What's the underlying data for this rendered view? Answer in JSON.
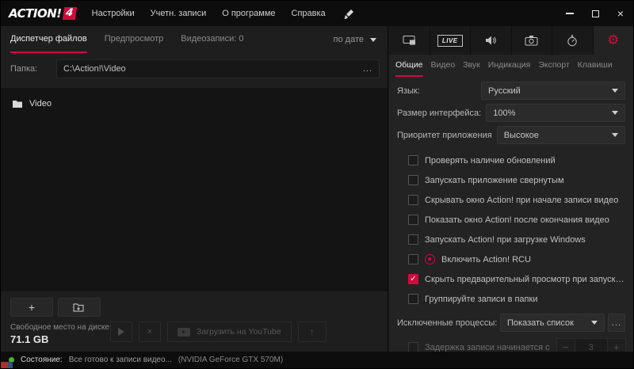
{
  "colors": {
    "accent": "#d10b3c",
    "status_green": "#4db32b"
  },
  "titlebar": {
    "logo_text": "ACTION!",
    "logo_badge": "4",
    "menu": [
      {
        "label": "Настройки"
      },
      {
        "label": "Учетн. записи"
      },
      {
        "label": "О программе"
      },
      {
        "label": "Справка"
      }
    ]
  },
  "files_panel": {
    "tabs": [
      {
        "label": "Диспетчер файлов"
      },
      {
        "label": "Предпросмотр"
      },
      {
        "label": "Видеозаписи: 0"
      }
    ],
    "sort_label": "по дате",
    "folder_label": "Папка:",
    "folder_path": "C:\\Action!\\Video",
    "browse_label": "...",
    "items": [
      {
        "label": "Video"
      }
    ],
    "free_space_label": "Свободное место на диске",
    "free_space_value": "71.1 GB",
    "youtube_button_label": "Загрузить на YouTube"
  },
  "settings_panel": {
    "live_tab_label": "LIVE",
    "tabs": [
      {
        "label": "Общие"
      },
      {
        "label": "Видео"
      },
      {
        "label": "Звук"
      },
      {
        "label": "Индикация"
      },
      {
        "label": "Экспорт"
      },
      {
        "label": "Клавиши"
      }
    ],
    "rows": [
      {
        "label": "Язык:",
        "value": "Русский"
      },
      {
        "label": "Размер интерфейса:",
        "value": "100%"
      },
      {
        "label": "Приоритет приложения",
        "value": "Высокое"
      }
    ],
    "checkboxes": [
      {
        "label": "Проверять наличие обновлений",
        "checked": false
      },
      {
        "label": "Запускать приложение свернутым",
        "checked": false
      },
      {
        "label": "Скрывать окно Action! при начале записи видео",
        "checked": false
      },
      {
        "label": "Показать окно Action! после окончания видео",
        "checked": false
      },
      {
        "label": "Запускать Action! при загрузке Windows",
        "checked": false
      },
      {
        "label": "Включить Action! RCU",
        "checked": false
      },
      {
        "label": "Скрыть предварительный просмотр при запуске записи",
        "checked": true
      },
      {
        "label": "Группируйте записи в папки",
        "checked": false
      }
    ],
    "excluded_label": "Исключенные процессы:",
    "excluded_value": "Показать список",
    "excluded_browse": "...",
    "delay": {
      "label": "Задержка записи начинается с",
      "value": "3",
      "checked": false
    }
  },
  "statusbar": {
    "label": "Состояние:",
    "text": "Все готово к записи видео...",
    "gpu": "(NVIDIA GeForce GTX 570M)"
  }
}
